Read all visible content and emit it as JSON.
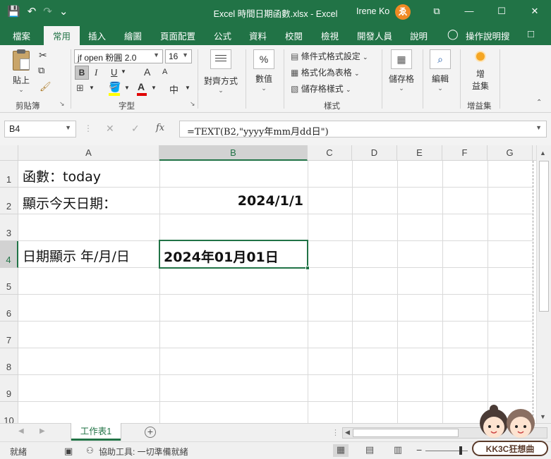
{
  "window": {
    "title": "Excel 時間日期函數.xlsx - Excel",
    "user": "Irene Ko",
    "avatar_letter": "ゑ",
    "quick_access": {
      "save": "💾",
      "undo": "↶",
      "redo": "↷",
      "customize": "⌄"
    },
    "controls": {
      "ribbon_display": "⧉",
      "minimize": "—",
      "maximize": "☐",
      "close": "✕"
    }
  },
  "tabs": [
    "檔案",
    "常用",
    "插入",
    "繪圖",
    "頁面配置",
    "公式",
    "資料",
    "校閱",
    "檢視",
    "開發人員",
    "說明"
  ],
  "active_tab": "常用",
  "tell_me": "操作說明搜",
  "ribbon": {
    "clipboard": {
      "paste": "貼上",
      "label": "剪貼簿"
    },
    "font": {
      "name": "jf open 粉圓 2.0",
      "size": "16",
      "bold": "B",
      "italic": "I",
      "underline": "U",
      "grow": "A",
      "shrink": "A",
      "phonetic": "中",
      "label": "字型"
    },
    "alignment": {
      "label": "對齊方式"
    },
    "number": {
      "symbol": "%",
      "label": "數值"
    },
    "styles": {
      "conditional": "條件式格式設定",
      "as_table": "格式化為表格",
      "cell_styles": "儲存格樣式",
      "label": "樣式"
    },
    "cells": {
      "label": "儲存格"
    },
    "editing": {
      "label": "編輯"
    },
    "addins": {
      "line1": "增",
      "line2": "益集",
      "label": "增益集"
    }
  },
  "formula_bar": {
    "name_box": "B4",
    "cancel": "✕",
    "enter": "✓",
    "fx": "fx",
    "formula": "=TEXT(B2,\"yyyy年mm月dd日\")"
  },
  "grid": {
    "columns": [
      "A",
      "B",
      "C",
      "D",
      "E",
      "F",
      "G"
    ],
    "rows": [
      "1",
      "2",
      "3",
      "4",
      "5",
      "6",
      "7",
      "8",
      "9",
      "10"
    ],
    "selected_column": "B",
    "selected_row": "4",
    "cells": {
      "A1": "函數：today",
      "A2": "顯示今天日期：",
      "B2": "2024/1/1",
      "A4": "日期顯示 年/月/日",
      "B4": "2024年01月01日"
    }
  },
  "sheet_tabs": {
    "active": "工作表1",
    "add": "+"
  },
  "status_bar": {
    "ready": "就緒",
    "accessibility": "協助工具: 一切準備就緒"
  },
  "logo": {
    "text": "KK3C狂想曲"
  },
  "colors": {
    "accent": "#217346",
    "title_bar": "#217346",
    "ribbon_bg": "#f3f3f3"
  }
}
